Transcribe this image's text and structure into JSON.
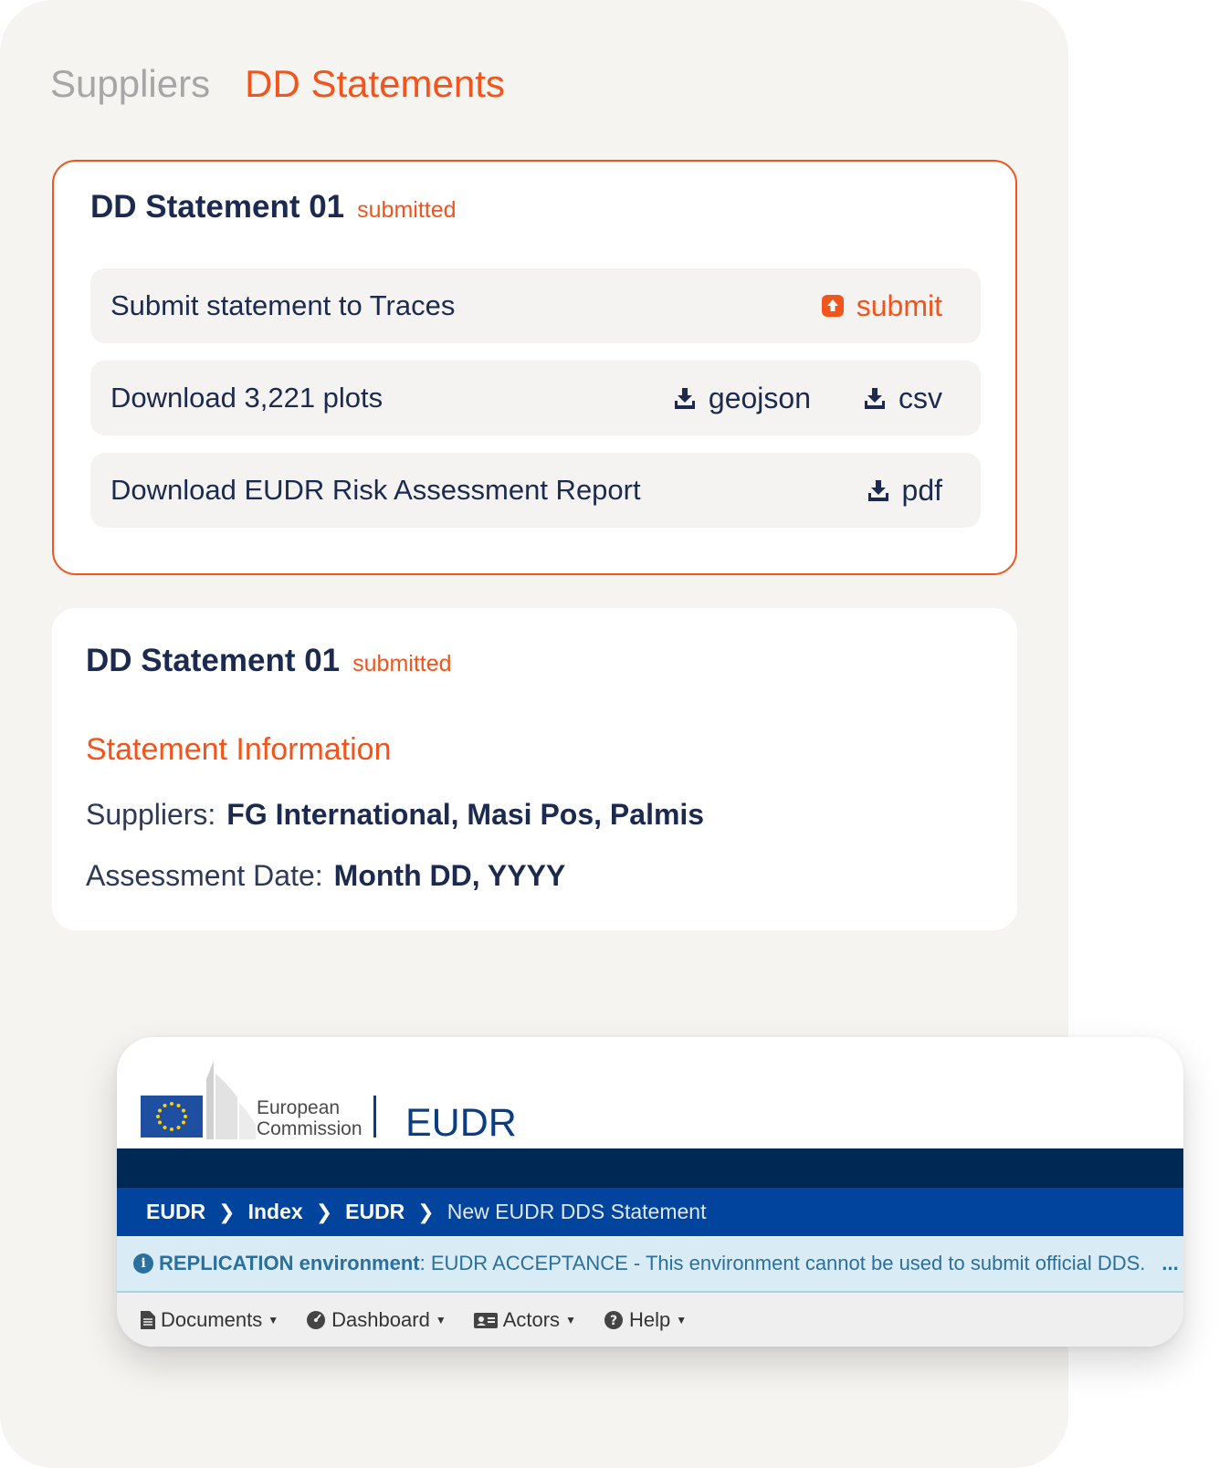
{
  "tabs": {
    "suppliers": "Suppliers",
    "dd_statements": "DD Statements"
  },
  "colors": {
    "accent": "#f2541b",
    "navy": "#1b2a4e",
    "eu_blue": "#00449e",
    "eu_dark": "#002855"
  },
  "card1": {
    "title": "DD Statement 01",
    "status": "submitted",
    "rows": [
      {
        "label": "Submit statement to Traces",
        "actions": [
          {
            "icon": "upload-icon",
            "label": "submit"
          }
        ]
      },
      {
        "label": "Download 3,221 plots",
        "actions": [
          {
            "icon": "download-icon",
            "label": "geojson"
          },
          {
            "icon": "download-icon",
            "label": "csv"
          }
        ]
      },
      {
        "label": "Download EUDR Risk Assessment Report",
        "actions": [
          {
            "icon": "download-icon",
            "label": "pdf"
          }
        ]
      }
    ]
  },
  "card2": {
    "title": "DD Statement 01",
    "status": "submitted",
    "section_title": "Statement Information",
    "suppliers_label": "Suppliers:",
    "suppliers_value": "FG International, Masi Pos, Palmis",
    "date_label": "Assessment Date:",
    "date_value": "Month DD, YYYY"
  },
  "eu": {
    "org_line1": "European",
    "org_line2": "Commission",
    "app": "EUDR",
    "breadcrumb": [
      "EUDR",
      "Index",
      "EUDR",
      "New EUDR DDS Statement"
    ],
    "notice_strong": "REPLICATION environment",
    "notice_text": ": EUDR ACCEPTANCE - This environment cannot be used to submit official DDS.",
    "notice_more": "...",
    "menu": [
      {
        "icon": "document-icon",
        "label": "Documents"
      },
      {
        "icon": "dashboard-icon",
        "label": "Dashboard"
      },
      {
        "icon": "id-card-icon",
        "label": "Actors"
      },
      {
        "icon": "help-icon",
        "label": "Help"
      }
    ]
  }
}
